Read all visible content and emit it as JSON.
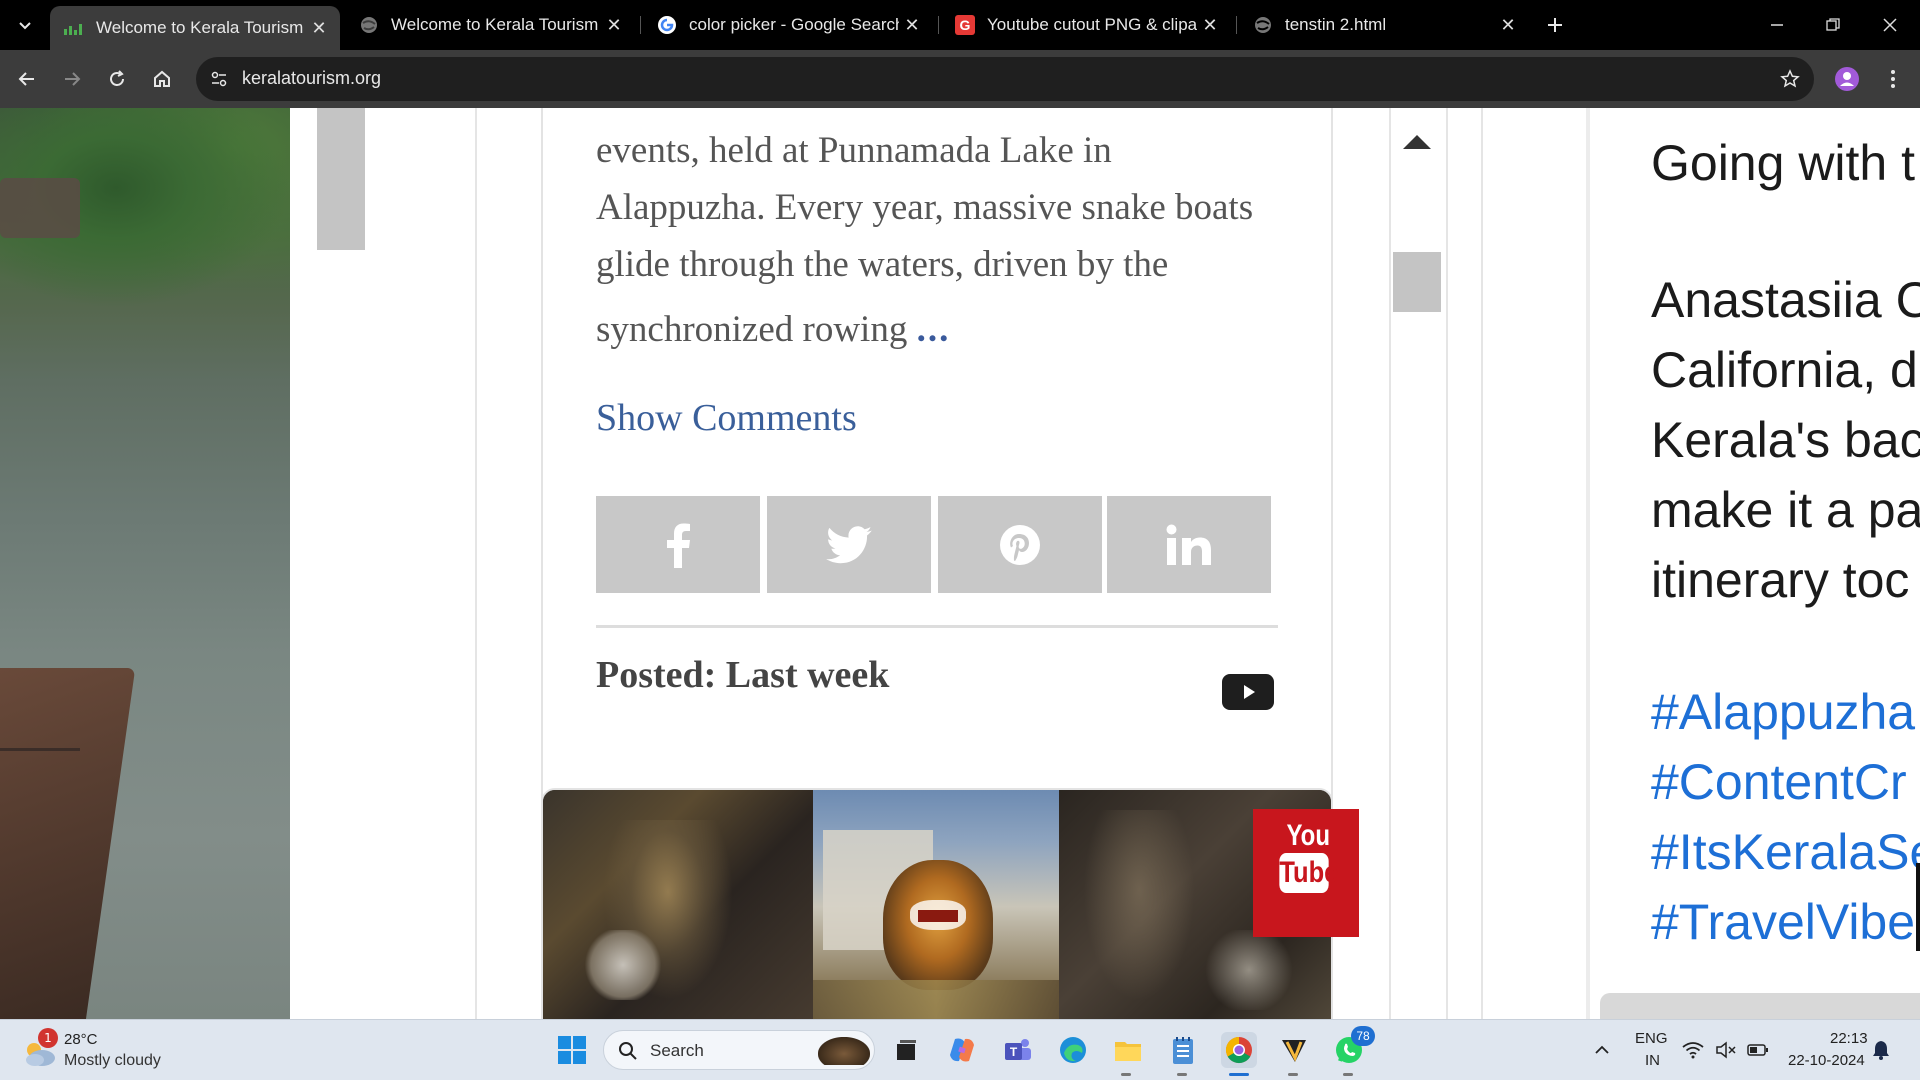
{
  "browser": {
    "tabs": [
      {
        "title": "Welcome to Kerala Tourism - Official",
        "active": true,
        "favicon": "kerala-favicon"
      },
      {
        "title": "Welcome to Kerala Tourism",
        "active": false,
        "favicon": "globe-icon"
      },
      {
        "title": "color picker - Google Search",
        "active": false,
        "favicon": "google-g-icon"
      },
      {
        "title": "Youtube cutout PNG & clipart images",
        "active": false,
        "favicon": "red-g-icon"
      },
      {
        "title": "tenstin 2.html",
        "active": false,
        "favicon": "globe-icon"
      }
    ],
    "url": "keralatourism.org"
  },
  "article": {
    "text_line1": "events, held at Punnamada Lake in",
    "text_line2": "Alappuzha. Every year, massive snake boats",
    "text_line3": "glide through the waters, driven by the",
    "text_line4": "synchronized rowing",
    "ellipsis": "...",
    "show_comments": "Show Comments",
    "share_buttons": [
      "facebook-icon",
      "twitter-icon",
      "pinterest-icon",
      "linkedin-icon"
    ],
    "posted": "Posted: Last week"
  },
  "video_thumb": {
    "logo_top": "You",
    "logo_bottom": "Tube"
  },
  "right_post": {
    "lines": [
      "Going with t",
      "",
      "Anastasiia C",
      "California, d",
      "Kerala's bac",
      "make it a pa",
      "itinerary toc"
    ],
    "hashtags": [
      "#Alappuzha",
      "#ContentCr",
      "#ItsKeralaSe",
      "#TravelVibe"
    ]
  },
  "taskbar": {
    "weather_badge": "1",
    "temperature": "28°C",
    "weather": "Mostly cloudy",
    "search_label": "Search",
    "whatsapp_badge": "78",
    "lang_line1": "ENG",
    "lang_line2": "IN",
    "time": "22:13",
    "date": "22-10-2024"
  },
  "colors": {
    "link_blue": "#3a5f9a",
    "hashtag_blue": "#1d6fd6",
    "share_gray": "#c8c8c8",
    "youtube_red": "#c8161d"
  }
}
